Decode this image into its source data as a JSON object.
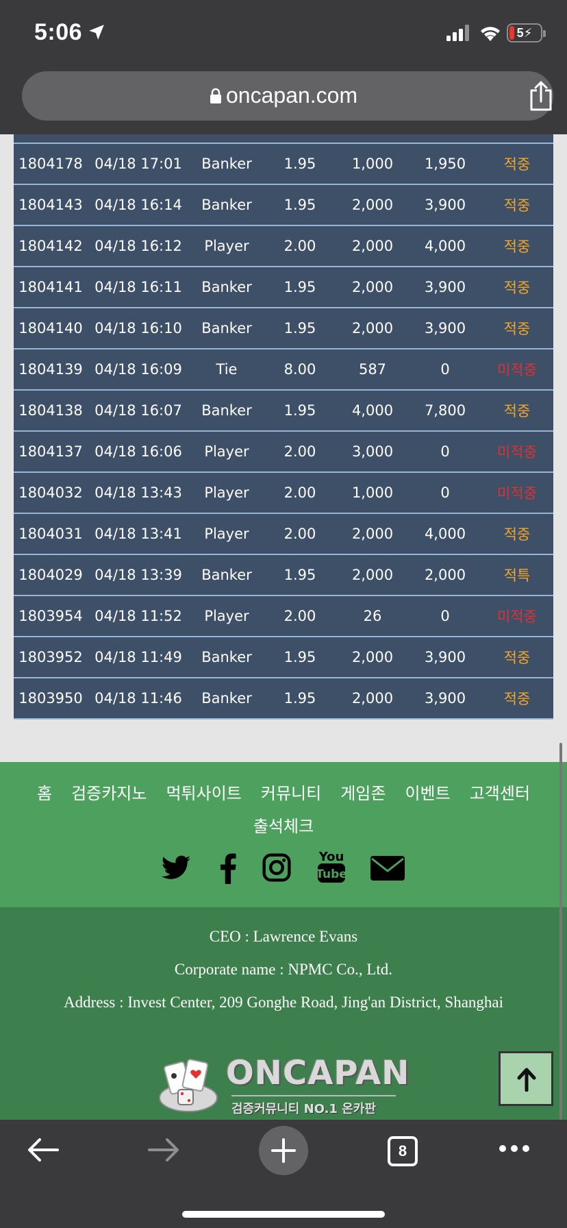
{
  "status_bar": {
    "time": "5:06",
    "battery": "5"
  },
  "browser": {
    "url": "oncapan.com"
  },
  "bet_history": {
    "rows": [
      {
        "id": "1804178",
        "datetime": "04/18 17:01",
        "pick": "Banker",
        "odds": "1.95",
        "bet": "1,000",
        "payout": "1,950",
        "result": "적중",
        "status": "hit"
      },
      {
        "id": "1804143",
        "datetime": "04/18 16:14",
        "pick": "Banker",
        "odds": "1.95",
        "bet": "2,000",
        "payout": "3,900",
        "result": "적중",
        "status": "hit"
      },
      {
        "id": "1804142",
        "datetime": "04/18 16:12",
        "pick": "Player",
        "odds": "2.00",
        "bet": "2,000",
        "payout": "4,000",
        "result": "적중",
        "status": "hit"
      },
      {
        "id": "1804141",
        "datetime": "04/18 16:11",
        "pick": "Banker",
        "odds": "1.95",
        "bet": "2,000",
        "payout": "3,900",
        "result": "적중",
        "status": "hit"
      },
      {
        "id": "1804140",
        "datetime": "04/18 16:10",
        "pick": "Banker",
        "odds": "1.95",
        "bet": "2,000",
        "payout": "3,900",
        "result": "적중",
        "status": "hit"
      },
      {
        "id": "1804139",
        "datetime": "04/18 16:09",
        "pick": "Tie",
        "odds": "8.00",
        "bet": "587",
        "payout": "0",
        "result": "미적중",
        "status": "miss"
      },
      {
        "id": "1804138",
        "datetime": "04/18 16:07",
        "pick": "Banker",
        "odds": "1.95",
        "bet": "4,000",
        "payout": "7,800",
        "result": "적중",
        "status": "hit"
      },
      {
        "id": "1804137",
        "datetime": "04/18 16:06",
        "pick": "Player",
        "odds": "2.00",
        "bet": "3,000",
        "payout": "0",
        "result": "미적중",
        "status": "miss"
      },
      {
        "id": "1804032",
        "datetime": "04/18 13:43",
        "pick": "Player",
        "odds": "2.00",
        "bet": "1,000",
        "payout": "0",
        "result": "미적중",
        "status": "miss"
      },
      {
        "id": "1804031",
        "datetime": "04/18 13:41",
        "pick": "Player",
        "odds": "2.00",
        "bet": "2,000",
        "payout": "4,000",
        "result": "적중",
        "status": "hit"
      },
      {
        "id": "1804029",
        "datetime": "04/18 13:39",
        "pick": "Banker",
        "odds": "1.95",
        "bet": "2,000",
        "payout": "2,000",
        "result": "적특",
        "status": "hit"
      },
      {
        "id": "1803954",
        "datetime": "04/18 11:52",
        "pick": "Player",
        "odds": "2.00",
        "bet": "26",
        "payout": "0",
        "result": "미적중",
        "status": "miss"
      },
      {
        "id": "1803952",
        "datetime": "04/18 11:49",
        "pick": "Banker",
        "odds": "1.95",
        "bet": "2,000",
        "payout": "3,900",
        "result": "적중",
        "status": "hit"
      },
      {
        "id": "1803950",
        "datetime": "04/18 11:46",
        "pick": "Banker",
        "odds": "1.95",
        "bet": "2,000",
        "payout": "3,900",
        "result": "적중",
        "status": "hit"
      }
    ]
  },
  "footer": {
    "nav": [
      "홈",
      "검증카지노",
      "먹튀사이트",
      "커뮤니티",
      "게임존",
      "이벤트",
      "고객센터"
    ],
    "nav_extra": "출석체크",
    "social": [
      "twitter-icon",
      "facebook-icon",
      "instagram-icon",
      "youtube-icon",
      "mail-icon"
    ]
  },
  "company": {
    "ceo": "CEO : Lawrence Evans",
    "corporate_name": "Corporate name : NPMC Co., Ltd.",
    "address": "Address : Invest Center, 209 Gonghe Road, Jing'an District, Shanghai",
    "logo_title": "ONCAPAN",
    "logo_subtitle": "검증커뮤니티 NO.1 온카판"
  },
  "toolbar": {
    "tab_count": "8"
  },
  "colors": {
    "hit": "#f5a623",
    "miss": "#e03131",
    "table_bg": "#3e5068",
    "footer_green": "#4ea05e",
    "company_green": "#3d7f4d"
  }
}
